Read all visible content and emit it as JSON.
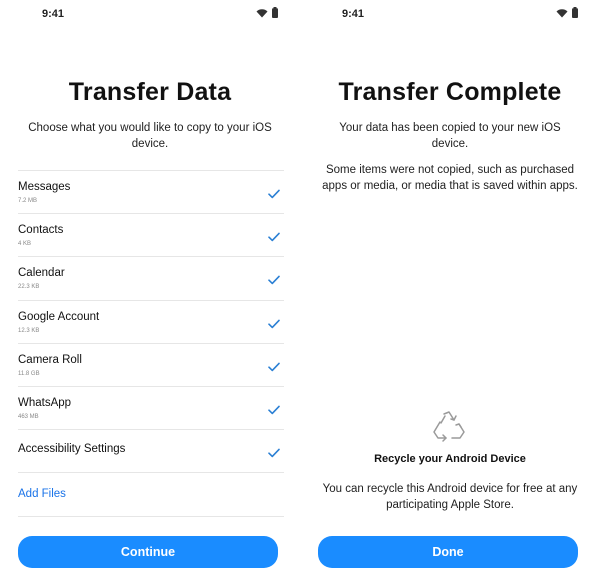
{
  "left": {
    "status": {
      "time": "9:41"
    },
    "title": "Transfer Data",
    "subtitle": "Choose what you would like to copy to your iOS device.",
    "items": [
      {
        "name": "Messages",
        "size": "7.2 MB"
      },
      {
        "name": "Contacts",
        "size": "4 KB"
      },
      {
        "name": "Calendar",
        "size": "22.3 KB"
      },
      {
        "name": "Google Account",
        "size": "12.3 KB"
      },
      {
        "name": "Camera Roll",
        "size": "11.8 GB"
      },
      {
        "name": "WhatsApp",
        "size": "463 MB"
      },
      {
        "name": "Accessibility Settings",
        "size": ""
      }
    ],
    "add_files_label": "Add Files",
    "button_label": "Continue"
  },
  "right": {
    "status": {
      "time": "9:41"
    },
    "title": "Transfer Complete",
    "subtitle_1": "Your data has been copied to your new iOS device.",
    "subtitle_2": "Some items were not copied, such as purchased apps or media, or media that is saved within apps.",
    "recycle_title": "Recycle your Android Device",
    "recycle_desc": "You can recycle this Android device for free at any participating Apple Store.",
    "button_label": "Done"
  },
  "icons": {
    "status": [
      "wifi-icon",
      "battery-icon"
    ],
    "item_check": "check-icon",
    "recycle": "recycle-icon"
  },
  "colors": {
    "accent": "#1a8cff",
    "link": "#1a73e8",
    "check": "#2a7fd4",
    "divider": "#e6e6e6"
  }
}
